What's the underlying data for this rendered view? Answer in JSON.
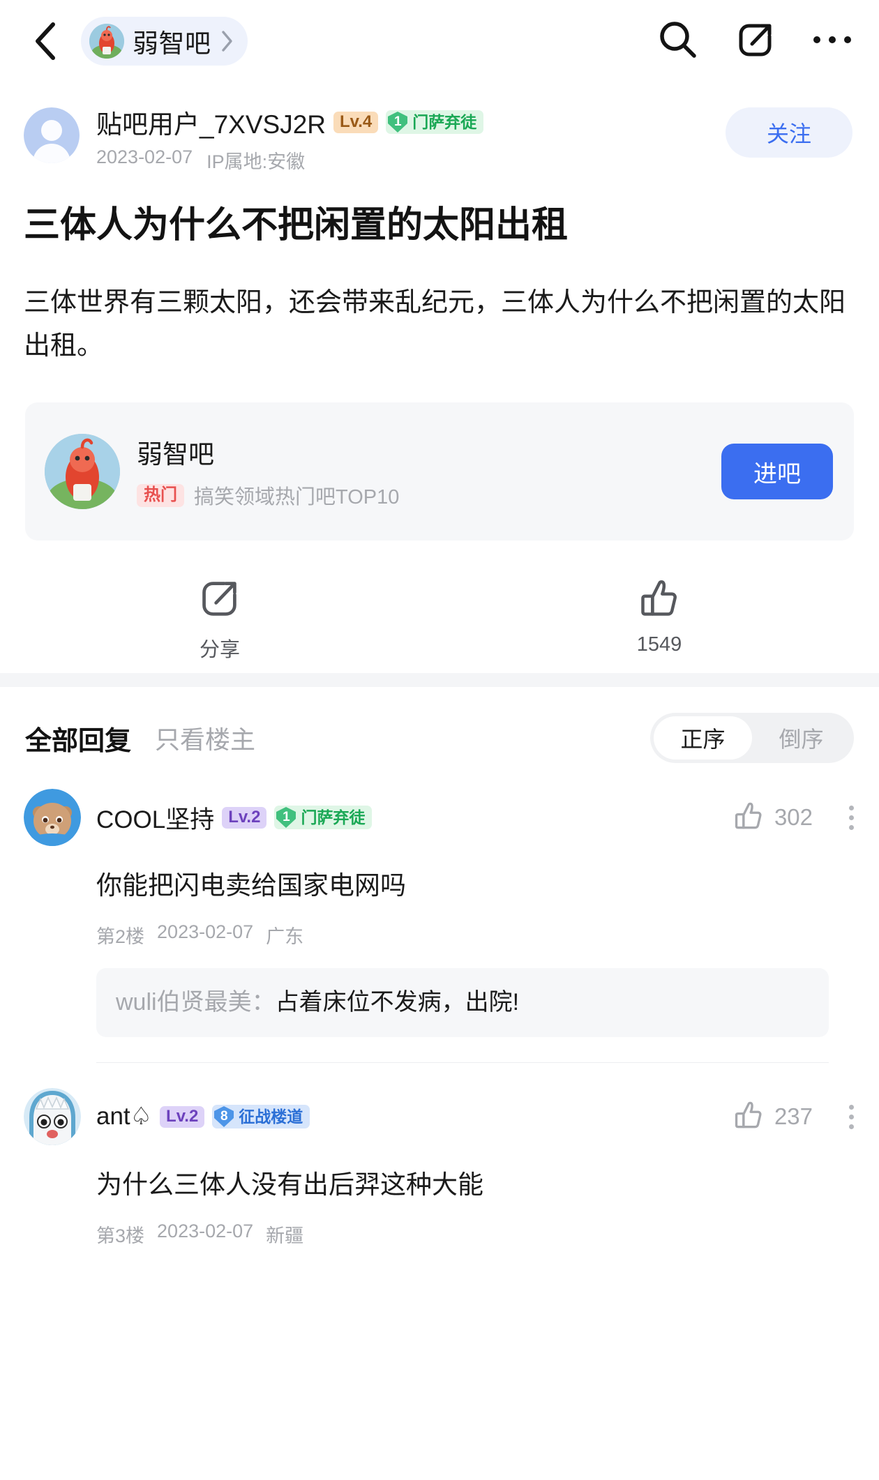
{
  "topbar": {
    "back_icon": "chevron-left-icon",
    "forum_pill": {
      "name": "弱智吧",
      "chevron": "chevron-right-icon"
    },
    "actions": [
      {
        "icon": "search-icon"
      },
      {
        "icon": "compose-icon"
      },
      {
        "icon": "more-horizontal-icon"
      }
    ]
  },
  "post": {
    "author": {
      "name": "贴吧用户_7XVSJ2R",
      "level": "Lv.4",
      "badge_num": "1",
      "badge_label": "门萨弃徒",
      "date": "2023-02-07",
      "ip": "IP属地:安徽"
    },
    "follow_label": "关注",
    "title": "三体人为什么不把闲置的太阳出租",
    "body": "三体世界有三颗太阳，还会带来乱纪元，三体人为什么不把闲置的太阳出租。",
    "forum_card": {
      "name": "弱智吧",
      "hot_badge": "热门",
      "desc": "搞笑领域热门吧TOP10",
      "enter_label": "进吧"
    },
    "actions": {
      "share_label": "分享",
      "share_icon": "compose-icon",
      "like_icon": "thumbs-up-icon",
      "like_count": "1549"
    }
  },
  "replies": {
    "tab_all": "全部回复",
    "tab_op": "只看楼主",
    "sort_asc": "正序",
    "sort_desc": "倒序",
    "items": [
      {
        "name": "COOL坚持",
        "level": "Lv.2",
        "badge_num": "1",
        "badge_label": "门萨弃徒",
        "badge_color": "green",
        "like_count": "302",
        "text": "你能把闪电卖给国家电网吗",
        "floor": "第2楼",
        "date": "2023-02-07",
        "location": "广东",
        "nested": {
          "user": "wuli伯贤最美：",
          "text": "占着床位不发病，出院!"
        }
      },
      {
        "name": "ant♤",
        "level": "Lv.2",
        "badge_num": "8",
        "badge_label": "征战楼道",
        "badge_color": "blue",
        "like_count": "237",
        "text": "为什么三体人没有出后羿这种大能",
        "floor": "第3楼",
        "date": "2023-02-07",
        "location": "新疆",
        "nested": null
      }
    ]
  },
  "colors": {
    "accent_blue": "#3b6ef0",
    "pill_bg": "#eef2fc",
    "card_bg": "#f6f7f9",
    "green_badge": "#1aa855",
    "blue_badge": "#2b6fd6",
    "hot_red": "#e8504f"
  }
}
